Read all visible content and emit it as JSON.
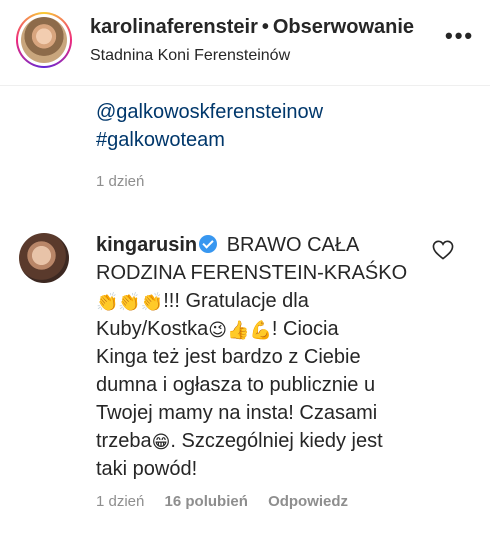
{
  "header": {
    "username": "karolinaferensteir",
    "separator": "•",
    "follow_label": "Obserwowanie",
    "location": "Stadnina Koni Ferensteinów",
    "more_icon": "more-dots-icon"
  },
  "previous_comment": {
    "mentions": [
      "@galkowoskferensteinow",
      "#galkowoteam"
    ],
    "time": "1 dzień"
  },
  "comment": {
    "username": "kingarusin",
    "line1": "BRAWO CAŁA",
    "line2": "RODZINA FERENSTEIN-KRAŚKO",
    "emoji_clap": "👏👏👏",
    "line3_tail": "!!! Gratulacje dla",
    "line4_head": "Kuby/Kostka",
    "emoji_group": "😉👍💪",
    "line4_tail": "! Ciocia",
    "line5": "Kinga też jest bardzo z Ciebie",
    "line6": "dumna i ogłasza to publicznie u",
    "line7": "Twojej mamy na insta! Czasami",
    "line8_head": "trzeba",
    "emoji_grin": "😁",
    "line8_tail": ". Szczególniej kiedy jest",
    "line9": "taki powód!",
    "time": "1 dzień",
    "likes": "16 polubień",
    "reply_label": "Odpowiedz",
    "verified_color": "#3897f0"
  }
}
